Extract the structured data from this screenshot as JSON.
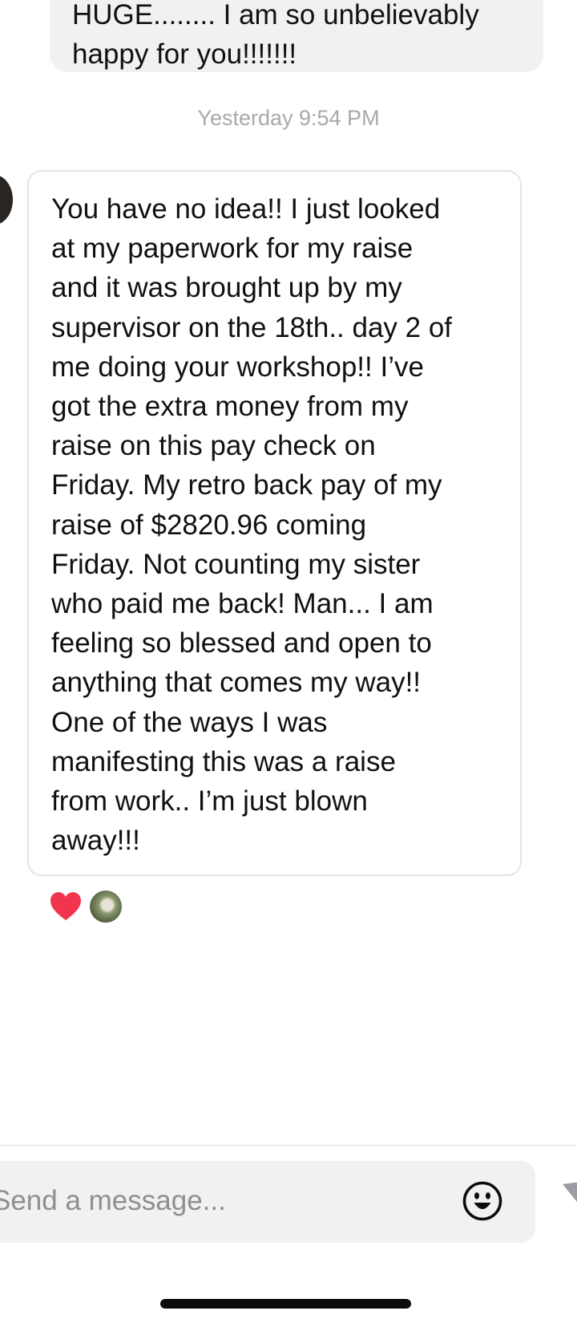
{
  "conversation": {
    "outgoing_message": {
      "lines": [
        "HUGE........ I am so unbelievably",
        "happy for you!!!!!!!"
      ]
    },
    "timestamp": "Yesterday 9:54 PM",
    "incoming_message": {
      "text": "You have no idea!! I just looked\nat my paperwork for my raise\nand it was brought up by my\nsupervisor on the 18th.. day 2 of\nme doing your workshop!! I’ve\ngot the extra money from my\nraise on this pay check on\nFriday. My retro back pay of my\nraise of $2820.96 coming\nFriday. Not counting my sister\nwho paid me back! Man... I am\nfeeling so blessed and open to\nanything that comes my way!!\nOne of the ways I was\nmanifesting this was a raise\nfrom work.. I’m just blown\naway!!!"
    },
    "reactions": [
      {
        "type": "heart-icon",
        "color": "#f2354e"
      },
      {
        "type": "avatar"
      }
    ]
  },
  "composer": {
    "placeholder": "Send a message...",
    "emoji_icon": "smiley-face-icon",
    "send_icon": "send-arrow-icon"
  },
  "colors": {
    "outgoing_bubble": "#f1f1f2",
    "timestamp": "#a9a9ad",
    "incoming_border": "#e4e4e6",
    "placeholder": "#8e8e93"
  }
}
